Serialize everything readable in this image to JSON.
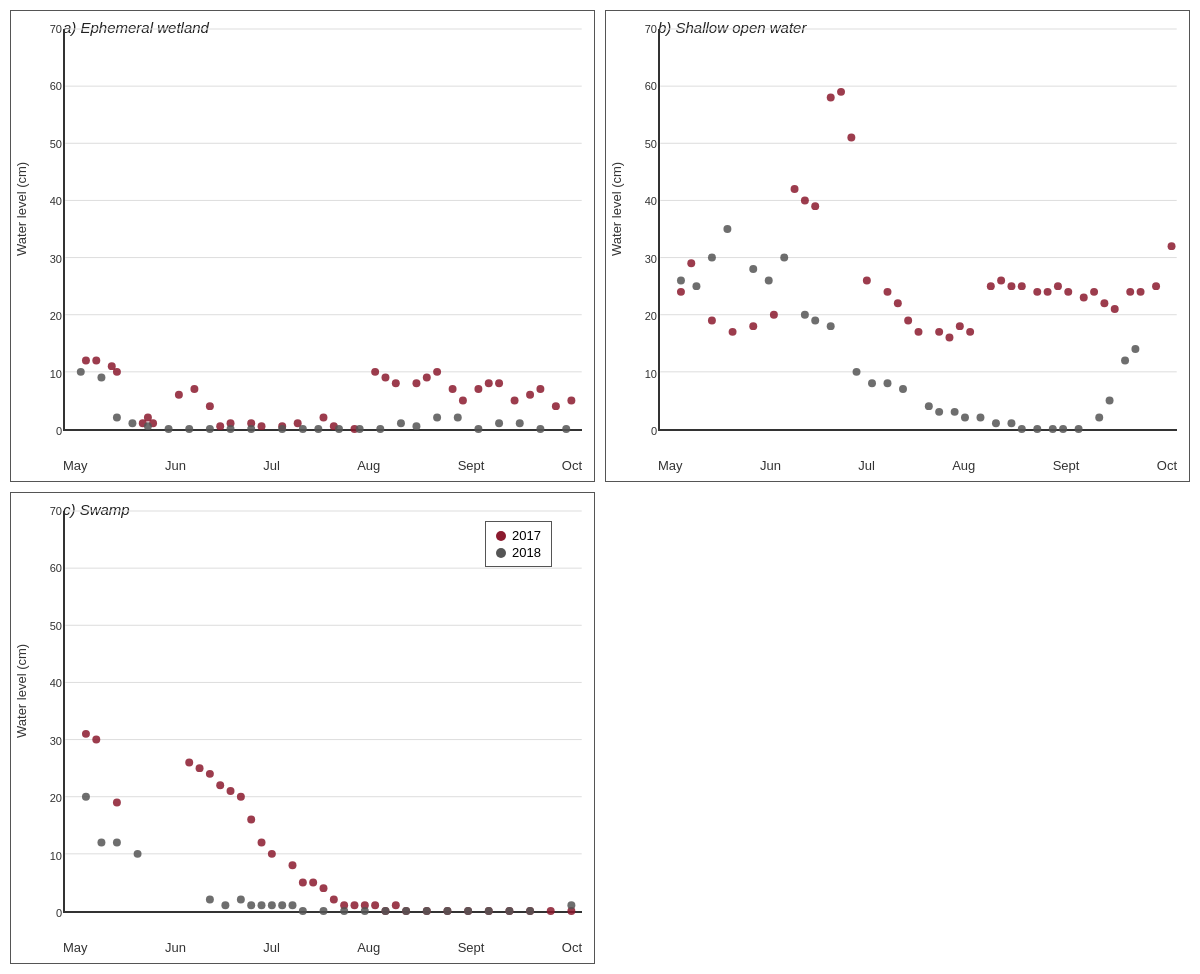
{
  "colors": {
    "red": "#8B1A2E",
    "gray": "#555555"
  },
  "panels": {
    "a": {
      "title": "a) Ephemeral wetland",
      "yLabel": "Water level (cm)",
      "yMax": 70,
      "xLabels": [
        "May",
        "Jun",
        "Jul",
        "Aug",
        "Sept",
        "Oct"
      ],
      "data2017": [
        [
          0.04,
          12
        ],
        [
          0.06,
          12
        ],
        [
          0.09,
          11
        ],
        [
          0.1,
          10
        ],
        [
          0.15,
          1
        ],
        [
          0.16,
          2
        ],
        [
          0.17,
          1
        ],
        [
          0.22,
          6
        ],
        [
          0.25,
          7
        ],
        [
          0.28,
          4
        ],
        [
          0.3,
          0.5
        ],
        [
          0.32,
          1
        ],
        [
          0.36,
          1
        ],
        [
          0.38,
          0.5
        ],
        [
          0.42,
          0.5
        ],
        [
          0.45,
          1
        ],
        [
          0.5,
          2
        ],
        [
          0.52,
          0.5
        ],
        [
          0.56,
          0
        ],
        [
          0.6,
          10
        ],
        [
          0.62,
          9
        ],
        [
          0.64,
          8
        ],
        [
          0.68,
          8
        ],
        [
          0.7,
          9
        ],
        [
          0.72,
          10
        ],
        [
          0.75,
          7
        ],
        [
          0.77,
          5
        ],
        [
          0.8,
          7
        ],
        [
          0.82,
          8
        ],
        [
          0.84,
          8
        ],
        [
          0.87,
          5
        ],
        [
          0.9,
          6
        ],
        [
          0.92,
          7
        ],
        [
          0.95,
          4
        ],
        [
          0.98,
          5
        ]
      ],
      "data2018": [
        [
          0.03,
          10
        ],
        [
          0.07,
          9
        ],
        [
          0.1,
          2
        ],
        [
          0.13,
          1
        ],
        [
          0.16,
          0.5
        ],
        [
          0.2,
          0
        ],
        [
          0.24,
          0
        ],
        [
          0.28,
          0
        ],
        [
          0.32,
          0
        ],
        [
          0.36,
          0
        ],
        [
          0.42,
          0
        ],
        [
          0.46,
          0
        ],
        [
          0.49,
          0
        ],
        [
          0.53,
          0
        ],
        [
          0.57,
          0
        ],
        [
          0.61,
          0
        ],
        [
          0.65,
          1
        ],
        [
          0.68,
          0.5
        ],
        [
          0.72,
          2
        ],
        [
          0.76,
          2
        ],
        [
          0.8,
          0
        ],
        [
          0.84,
          1
        ],
        [
          0.88,
          1
        ],
        [
          0.92,
          0
        ],
        [
          0.97,
          0
        ]
      ]
    },
    "b": {
      "title": "b) Shallow open water",
      "yLabel": "Water level (cm)",
      "yMax": 70,
      "xLabels": [
        "May",
        "Jun",
        "Jul",
        "Aug",
        "Sept",
        "Oct"
      ],
      "data2017": [
        [
          0.04,
          24
        ],
        [
          0.06,
          29
        ],
        [
          0.1,
          19
        ],
        [
          0.14,
          17
        ],
        [
          0.18,
          18
        ],
        [
          0.22,
          20
        ],
        [
          0.26,
          42
        ],
        [
          0.28,
          40
        ],
        [
          0.3,
          39
        ],
        [
          0.33,
          58
        ],
        [
          0.35,
          59
        ],
        [
          0.37,
          51
        ],
        [
          0.4,
          26
        ],
        [
          0.44,
          24
        ],
        [
          0.46,
          22
        ],
        [
          0.48,
          19
        ],
        [
          0.5,
          17
        ],
        [
          0.54,
          17
        ],
        [
          0.56,
          16
        ],
        [
          0.58,
          18
        ],
        [
          0.6,
          17
        ],
        [
          0.64,
          25
        ],
        [
          0.66,
          26
        ],
        [
          0.68,
          25
        ],
        [
          0.7,
          25
        ],
        [
          0.73,
          24
        ],
        [
          0.75,
          24
        ],
        [
          0.77,
          25
        ],
        [
          0.79,
          24
        ],
        [
          0.82,
          23
        ],
        [
          0.84,
          24
        ],
        [
          0.86,
          22
        ],
        [
          0.88,
          21
        ],
        [
          0.91,
          24
        ],
        [
          0.93,
          24
        ],
        [
          0.96,
          25
        ],
        [
          0.99,
          32
        ]
      ],
      "data2018": [
        [
          0.04,
          26
        ],
        [
          0.07,
          25
        ],
        [
          0.1,
          30
        ],
        [
          0.13,
          35
        ],
        [
          0.18,
          28
        ],
        [
          0.21,
          26
        ],
        [
          0.24,
          30
        ],
        [
          0.28,
          20
        ],
        [
          0.3,
          19
        ],
        [
          0.33,
          18
        ],
        [
          0.38,
          10
        ],
        [
          0.41,
          8
        ],
        [
          0.44,
          8
        ],
        [
          0.47,
          7
        ],
        [
          0.52,
          4
        ],
        [
          0.54,
          3
        ],
        [
          0.57,
          3
        ],
        [
          0.59,
          2
        ],
        [
          0.62,
          2
        ],
        [
          0.65,
          1
        ],
        [
          0.68,
          1
        ],
        [
          0.7,
          0
        ],
        [
          0.73,
          0
        ],
        [
          0.76,
          0
        ],
        [
          0.78,
          0
        ],
        [
          0.81,
          0
        ],
        [
          0.85,
          2
        ],
        [
          0.87,
          5
        ],
        [
          0.9,
          12
        ],
        [
          0.92,
          14
        ]
      ]
    },
    "c": {
      "title": "c) Swamp",
      "yLabel": "Water level (cm)",
      "yMax": 70,
      "xLabels": [
        "May",
        "Jun",
        "Jul",
        "Aug",
        "Sept",
        "Oct"
      ],
      "data2017": [
        [
          0.04,
          31
        ],
        [
          0.06,
          30
        ],
        [
          0.1,
          19
        ],
        [
          0.24,
          26
        ],
        [
          0.26,
          25
        ],
        [
          0.28,
          24
        ],
        [
          0.3,
          22
        ],
        [
          0.32,
          21
        ],
        [
          0.34,
          20
        ],
        [
          0.36,
          16
        ],
        [
          0.38,
          12
        ],
        [
          0.4,
          10
        ],
        [
          0.44,
          8
        ],
        [
          0.46,
          5
        ],
        [
          0.48,
          5
        ],
        [
          0.5,
          4
        ],
        [
          0.52,
          2
        ],
        [
          0.54,
          1
        ],
        [
          0.56,
          1
        ],
        [
          0.58,
          1
        ],
        [
          0.6,
          1
        ],
        [
          0.62,
          0
        ],
        [
          0.64,
          1
        ],
        [
          0.66,
          0
        ],
        [
          0.7,
          0
        ],
        [
          0.74,
          0
        ],
        [
          0.78,
          0
        ],
        [
          0.82,
          0
        ],
        [
          0.86,
          0
        ],
        [
          0.9,
          0
        ],
        [
          0.94,
          0
        ],
        [
          0.98,
          0
        ]
      ],
      "data2018": [
        [
          0.04,
          20
        ],
        [
          0.07,
          12
        ],
        [
          0.1,
          12
        ],
        [
          0.14,
          10
        ],
        [
          0.28,
          2
        ],
        [
          0.31,
          1
        ],
        [
          0.34,
          2
        ],
        [
          0.36,
          1
        ],
        [
          0.38,
          1
        ],
        [
          0.4,
          1
        ],
        [
          0.42,
          1
        ],
        [
          0.44,
          1
        ],
        [
          0.46,
          0
        ],
        [
          0.5,
          0
        ],
        [
          0.54,
          0
        ],
        [
          0.58,
          0
        ],
        [
          0.62,
          0
        ],
        [
          0.66,
          0
        ],
        [
          0.7,
          0
        ],
        [
          0.74,
          0
        ],
        [
          0.78,
          0
        ],
        [
          0.82,
          0
        ],
        [
          0.86,
          0
        ],
        [
          0.9,
          0
        ],
        [
          0.98,
          1
        ]
      ]
    }
  },
  "legend": {
    "items": [
      {
        "label": "2017",
        "color": "#8B1A2E"
      },
      {
        "label": "2018",
        "color": "#555555"
      }
    ]
  }
}
